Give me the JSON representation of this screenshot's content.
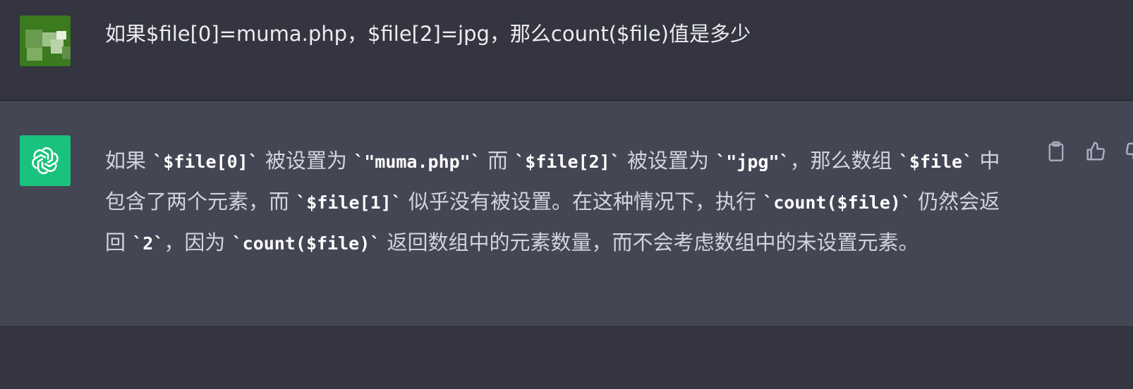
{
  "colors": {
    "background": "#343541",
    "assistant_row": "#444654",
    "openai_green": "#19c37d",
    "user_avatar_green": "#3b7a1f"
  },
  "user_message": {
    "avatar_icon": "user-avatar-icon",
    "text": "如果$file[0]=muma.php，$file[2]=jpg，那么count($file)值是多少"
  },
  "assistant_message": {
    "avatar_icon": "openai-logo-icon",
    "segments": [
      {
        "t": "text",
        "v": "如果 "
      },
      {
        "t": "code",
        "v": "`$file[0]`"
      },
      {
        "t": "text",
        "v": " 被设置为 "
      },
      {
        "t": "code",
        "v": "`\"muma.php\"`"
      },
      {
        "t": "text",
        "v": " 而 "
      },
      {
        "t": "code",
        "v": "`$file[2]`"
      },
      {
        "t": "text",
        "v": " 被设置为 "
      },
      {
        "t": "code",
        "v": "`\"jpg\"`"
      },
      {
        "t": "text",
        "v": "，那么数组 "
      },
      {
        "t": "code",
        "v": "`$file`"
      },
      {
        "t": "text",
        "v": " 中包含了两个元素，而 "
      },
      {
        "t": "code",
        "v": "`$file[1]`"
      },
      {
        "t": "text",
        "v": " 似乎没有被设置。在这种情况下，执行 "
      },
      {
        "t": "code",
        "v": "`count($file)`"
      },
      {
        "t": "text",
        "v": " 仍然会返回 "
      },
      {
        "t": "code",
        "v": "`2`"
      },
      {
        "t": "text",
        "v": "，因为 "
      },
      {
        "t": "code",
        "v": "`count($file)`"
      },
      {
        "t": "text",
        "v": " 返回数组中的元素数量，而不会考虑数组中的未设置元素。"
      }
    ]
  },
  "actions": [
    {
      "icon": "clipboard-icon"
    },
    {
      "icon": "thumbs-up-icon"
    },
    {
      "icon": "thumbs-down-icon"
    }
  ]
}
